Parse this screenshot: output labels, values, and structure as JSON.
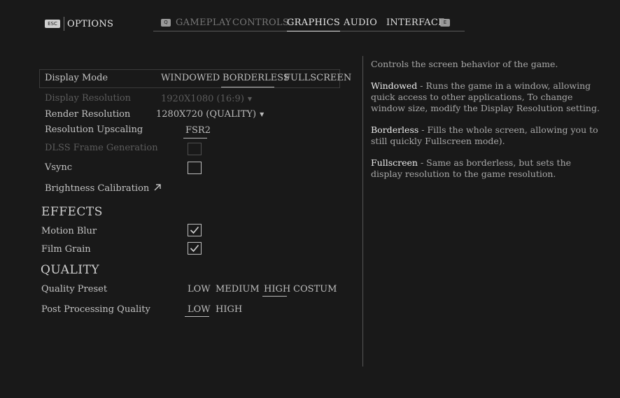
{
  "header": {
    "esc_key": "ESC",
    "title": "OPTIONS",
    "prev_key": "Q",
    "next_key": "E",
    "tabs": [
      {
        "label": "GAMEPLAY"
      },
      {
        "label": "CONTROLS"
      },
      {
        "label": "GRAPHICS"
      },
      {
        "label": "AUDIO"
      },
      {
        "label": "INTERFACE"
      }
    ]
  },
  "display_mode": {
    "label": "Display Mode",
    "options": [
      "WINDOWED",
      "BORDERLESS",
      "FULLSCREEN"
    ],
    "selected": "BORDERLESS"
  },
  "settings": {
    "display_resolution": {
      "label": "Display Resolution",
      "value": "1920X1080 (16:9)"
    },
    "render_resolution": {
      "label": "Render Resolution",
      "value": "1280X720 (QUALITY)"
    },
    "resolution_upscaling": {
      "label": "Resolution Upscaling",
      "value": "FSR2"
    },
    "dlss_frame_generation": {
      "label": "DLSS Frame Generation",
      "checked": false
    },
    "vsync": {
      "label": "Vsync",
      "checked": false
    },
    "brightness_calibration": {
      "label": "Brightness Calibration"
    }
  },
  "effects": {
    "heading": "EFFECTS",
    "motion_blur": {
      "label": "Motion Blur",
      "checked": true
    },
    "film_grain": {
      "label": "Film Grain",
      "checked": true
    }
  },
  "quality": {
    "heading": "QUALITY",
    "preset": {
      "label": "Quality Preset",
      "options": [
        "LOW",
        "MEDIUM",
        "HIGH",
        "COSTUM"
      ],
      "selected": "HIGH"
    },
    "post_processing": {
      "label": "Post Processing Quality",
      "options": [
        "LOW",
        "HIGH"
      ],
      "selected": "LOW"
    }
  },
  "description": {
    "intro": "Controls the screen behavior of the game.",
    "windowed_term": "Windowed",
    "windowed_text": " - Runs the game in a window, allowing quick access to other applications, To change window size, modify the Display Resolution setting.",
    "borderless_term": "Borderless",
    "borderless_text": " - Fills the whole screen, allowing you to still quickly Fullscreen mode).",
    "fullscreen_term": "Fullscreen",
    "fullscreen_text": " - Same as borderless, but sets the display resolution to the game resolution."
  }
}
